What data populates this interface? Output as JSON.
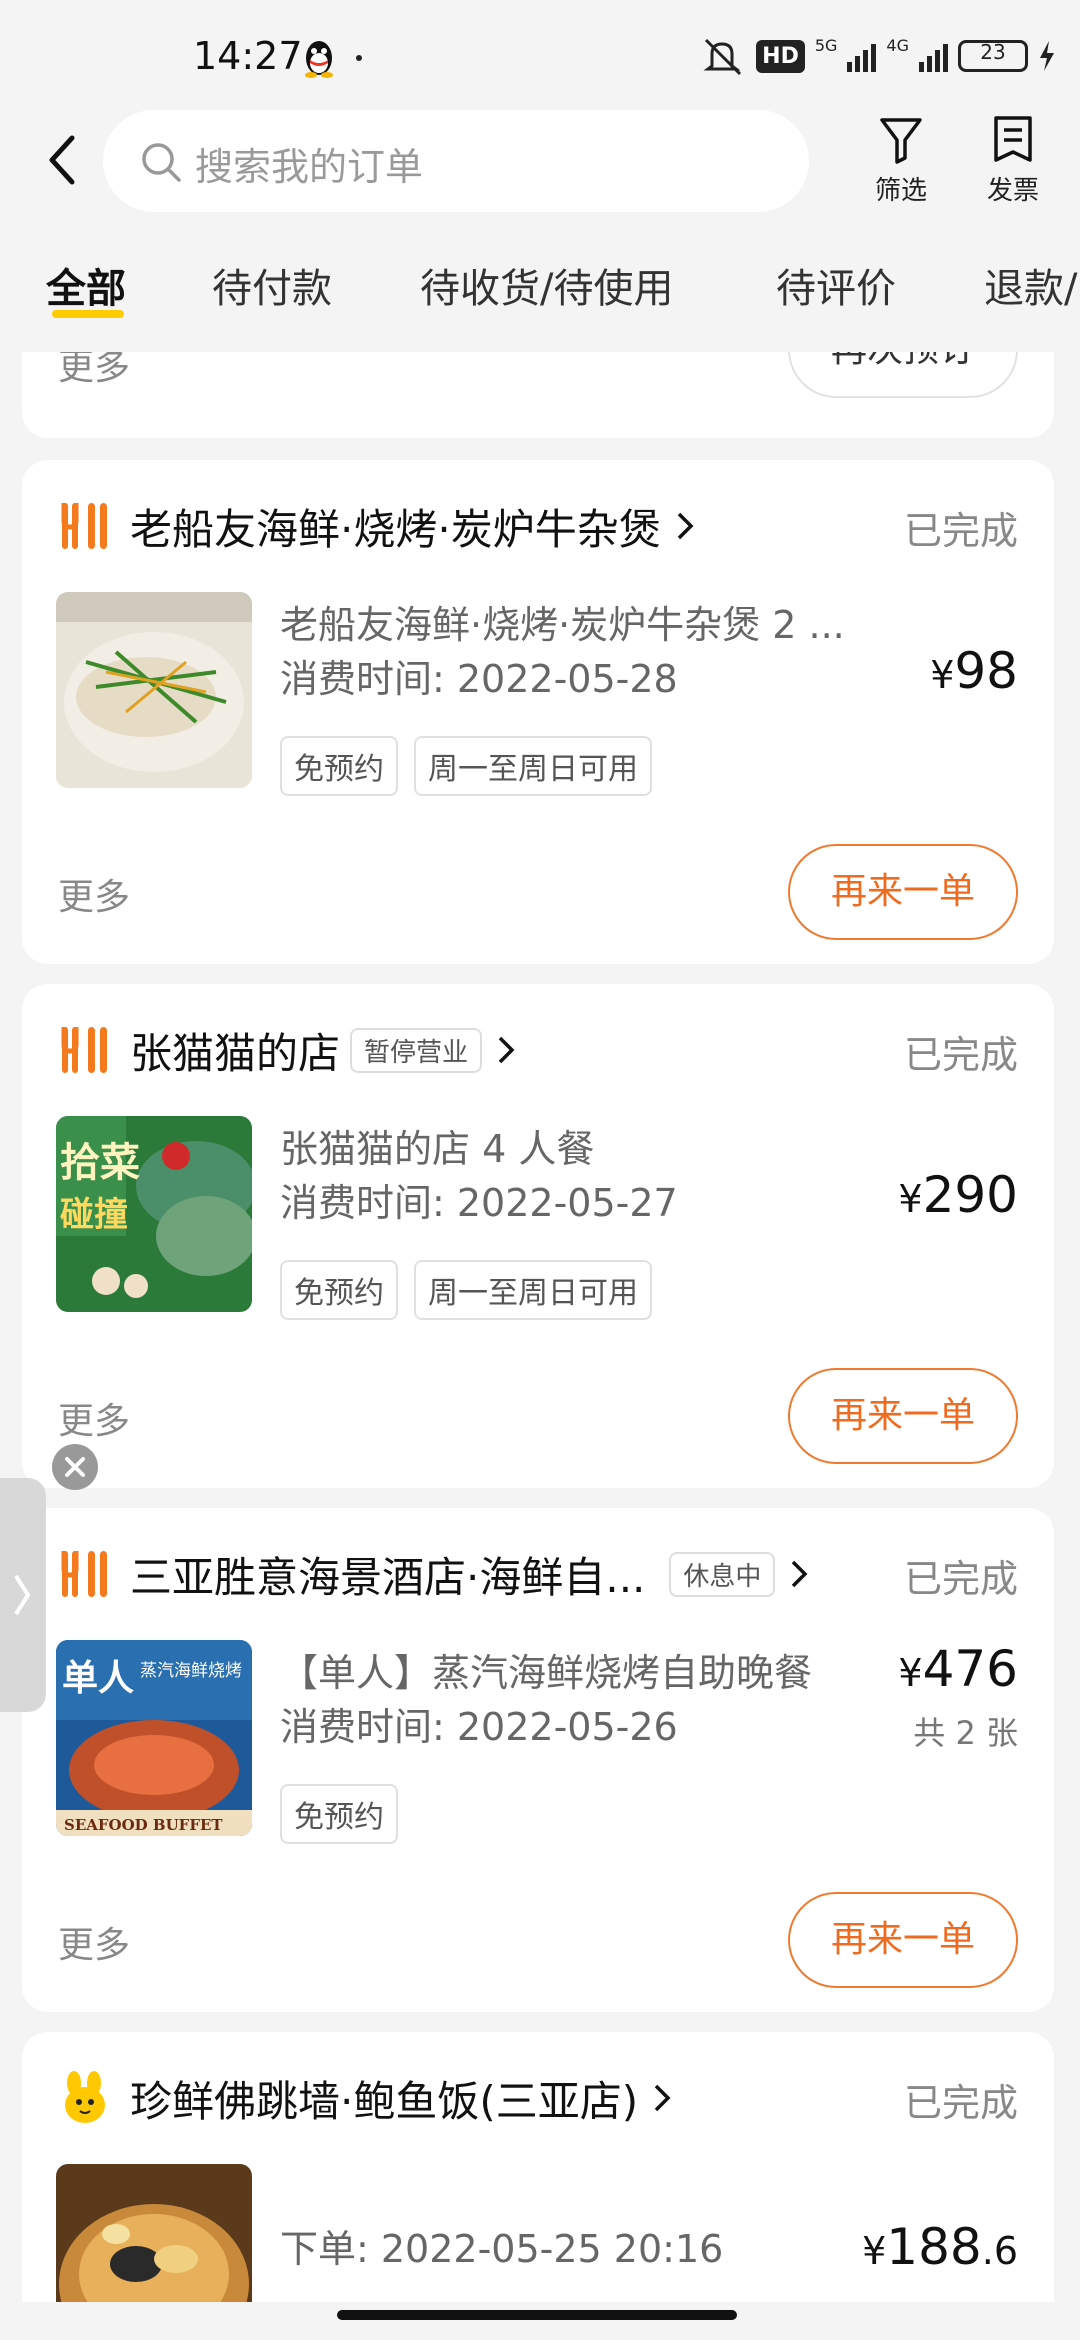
{
  "status_bar": {
    "time": "14:27",
    "icons": [
      "qq-icon",
      "mute-icon",
      "hd-icon",
      "signal-5g-icon",
      "signal-4g-icon",
      "battery-icon",
      "charging-icon"
    ],
    "hd_label": "HD",
    "net1": "5G",
    "net2": "4G",
    "battery": "23"
  },
  "header": {
    "search_placeholder": "搜索我的订单",
    "filter_label": "筛选",
    "invoice_label": "发票"
  },
  "tabs": [
    "全部",
    "待付款",
    "待收货/待使用",
    "待评价",
    "退款/"
  ],
  "partial_card": {
    "more": "更多",
    "button": "再次预订"
  },
  "orders": [
    {
      "shop": "老船友海鲜·烧烤·炭炉牛杂煲",
      "badge": "",
      "status": "已完成",
      "title": "老船友海鲜·烧烤·炭炉牛杂煲 2 ...",
      "time": "消费时间: 2022-05-28",
      "chips": [
        "免预约",
        "周一至周日可用"
      ],
      "price_symbol": "¥",
      "price": "98",
      "more": "更多",
      "button": "再来一单"
    },
    {
      "shop": "张猫猫的店",
      "badge": "暂停营业",
      "status": "已完成",
      "title": "张猫猫的店 4 人餐",
      "time": "消费时间: 2022-05-27",
      "chips": [
        "免预约",
        "周一至周日可用"
      ],
      "price_symbol": "¥",
      "price": "290",
      "more": "更多",
      "button": "再来一单"
    },
    {
      "shop": "三亚胜意海景酒店·海鲜自...",
      "badge": "休息中",
      "status": "已完成",
      "title": "【单人】蒸汽海鲜烧烤自助晚餐",
      "time": "消费时间: 2022-05-26",
      "chips": [
        "免预约"
      ],
      "price_symbol": "¥",
      "price": "476",
      "qty": "共 2 张",
      "thumb_text1": "单人",
      "thumb_text2": "蒸汽海鲜烧烤",
      "thumb_text3": "SEAFOOD BUFFET",
      "more": "更多",
      "button": "再来一单"
    },
    {
      "shop": "珍鲜佛跳墙·鲍鱼饭(三亚店)",
      "badge": "",
      "status": "已完成",
      "time": "下单: 2022-05-25 20:16",
      "price_symbol": "¥",
      "price": "188",
      "price_decimal": ".6"
    }
  ],
  "colors": {
    "accent": "#f06a20",
    "tab_underline": "#ffcc00",
    "background": "#f4f4f4"
  }
}
